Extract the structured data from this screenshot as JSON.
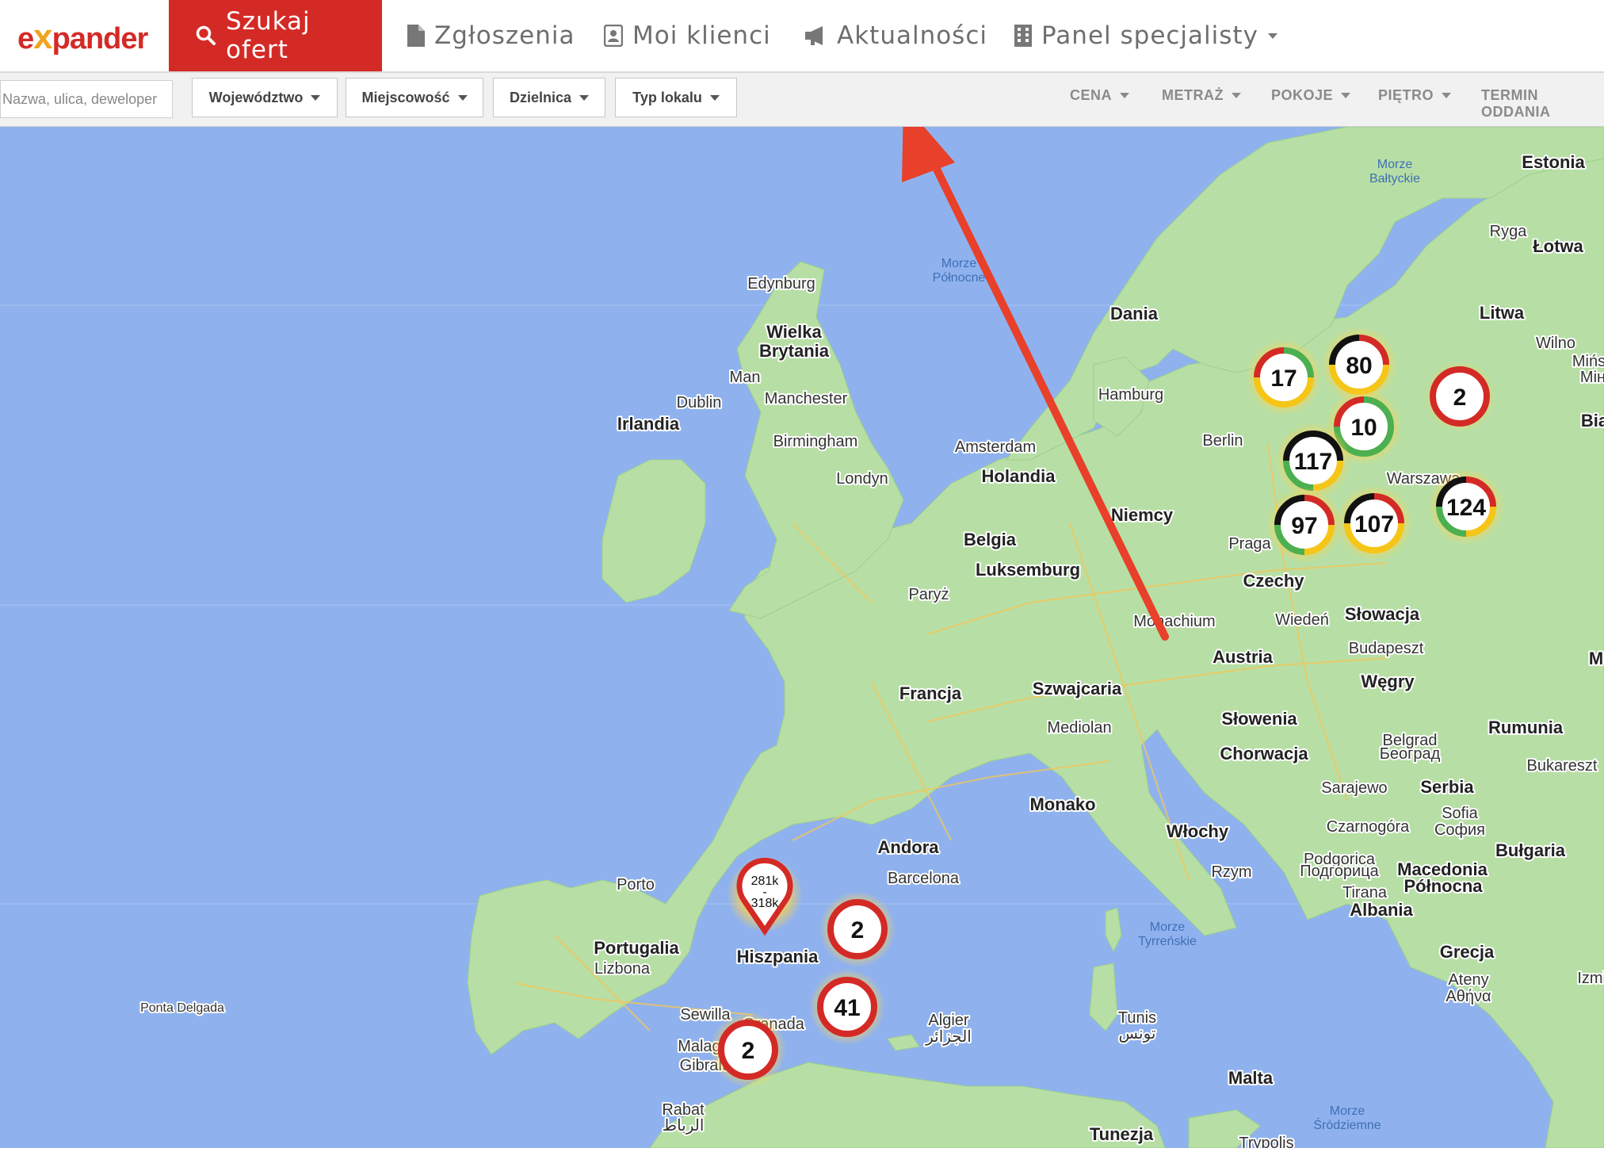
{
  "app": {
    "logo_part1": "e",
    "logo_x": "x",
    "logo_part2": "pander",
    "brand_color": "#d42a26"
  },
  "nav": {
    "items": [
      {
        "label": "Szukaj ofert",
        "icon": "search-icon",
        "active": true
      },
      {
        "label": "Zgłoszenia",
        "icon": "document-icon"
      },
      {
        "label": "Moi klienci",
        "icon": "contacts-icon"
      },
      {
        "label": "Aktualności",
        "icon": "megaphone-icon"
      },
      {
        "label": "Panel specjalisty",
        "icon": "building-icon"
      }
    ]
  },
  "filters": {
    "search_placeholder": "Nazwa, ulica, deweloper",
    "dropdowns": [
      "Województwo",
      "Miejscowość",
      "Dzielnica",
      "Typ lokalu"
    ],
    "sort": [
      "CENA",
      "METRAŻ",
      "POKOJE",
      "PIĘTRO",
      "TERMIN ODDANIA"
    ]
  },
  "map": {
    "countries": [
      "Estonia",
      "Łotwa",
      "Litwa",
      "Dania",
      "Wielka",
      "Brytania",
      "Irlandia",
      "Holandia",
      "Belgia",
      "Luksemburg",
      "Niemcy",
      "Czechy",
      "Słowacja",
      "Austria",
      "Węgry",
      "Szwajcaria",
      "Francja",
      "Słowenia",
      "Chorwacja",
      "Rumunia",
      "Serbia",
      "Bułgaria",
      "Włochy",
      "Monako",
      "Andora",
      "Hiszpania",
      "Portugalia",
      "Macedonia",
      "Północna",
      "Albania",
      "Grecja",
      "Malta",
      "Bia",
      "M"
    ],
    "cities": [
      "Ryga",
      "Wilno",
      "Mińsk",
      "Мін",
      "Hamburg",
      "Berlin",
      "Warszawa",
      "Amsterdam",
      "Edynburg",
      "Man",
      "Manchester",
      "Dublin",
      "Birmingham",
      "Londyn",
      "Paryż",
      "Praga",
      "Wiedeń",
      "Monachium",
      "Budapeszt",
      "Mediolan",
      "Belgrad",
      "Београд",
      "Bukareszt",
      "Sarajewo",
      "Sofia",
      "София",
      "Czarnogóra",
      "Podgorica",
      "Подгорица",
      "Rzym",
      "Tirana",
      "Ateny",
      "Αθήνα",
      "Barcelona",
      "Porto",
      "Lizbona",
      "Sewilla",
      "Granada",
      "Malaga",
      "Gibraltar",
      "Rabat",
      "الرباط",
      "Algier",
      "الجزائر",
      "Tunis",
      "تونس",
      "Tunezja",
      "Trypolis",
      "Izmir",
      "Ponta Delgada"
    ],
    "seas": [
      "Morze",
      "Bałtyckie",
      "Morze",
      "Północne",
      "Morze",
      "Tyrreńskie",
      "Morze",
      "Śródziemne"
    ],
    "clusters": [
      "17",
      "80",
      "2",
      "10",
      "117",
      "124",
      "97",
      "107",
      "2",
      "41",
      "2"
    ],
    "pin": {
      "line1": "281k",
      "line2": "-",
      "line3": "318k"
    },
    "water_color": "#8fb2ee",
    "land_color": "#b7dfa5"
  }
}
